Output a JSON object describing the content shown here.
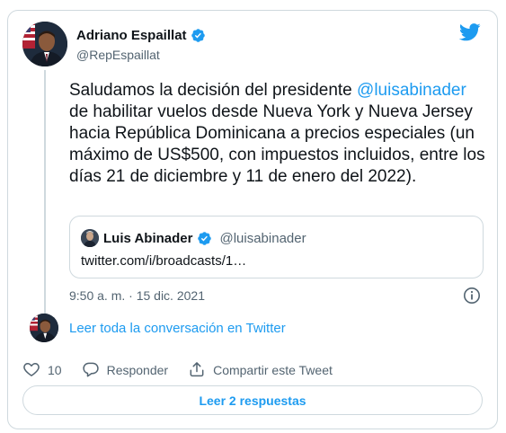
{
  "author": {
    "display_name": "Adriano Espaillat",
    "handle": "@RepEspaillat",
    "verified": true
  },
  "tweet": {
    "text_before": "Saludamos la decisión del presidente ",
    "mention": "@luisabinader",
    "text_after": " de habilitar vuelos desde Nueva York y Nueva Jersey hacia República Dominicana a precios especiales (un máximo de US$500, con impuestos incluidos, entre los días 21 de diciembre y 11 de enero del 2022)."
  },
  "quoted_tweet": {
    "display_name": "Luis Abinader",
    "handle": "@luisabinader",
    "verified": true,
    "body": "twitter.com/i/broadcasts/1…"
  },
  "timestamp": "9:50 a. m. · 15 dic. 2021",
  "read_conversation": "Leer toda la conversación en Twitter",
  "actions": {
    "like_count": "10",
    "reply_label": "Responder",
    "share_label": "Compartir este Tweet"
  },
  "replies_button": "Leer 2 respuestas",
  "colors": {
    "accent": "#1d9bf0",
    "text": "#0f1419",
    "muted": "#536471",
    "border": "#cfd9de"
  },
  "icons": [
    "twitter-bird-icon",
    "verified-badge-icon",
    "info-icon",
    "heart-icon",
    "reply-icon",
    "share-icon"
  ]
}
